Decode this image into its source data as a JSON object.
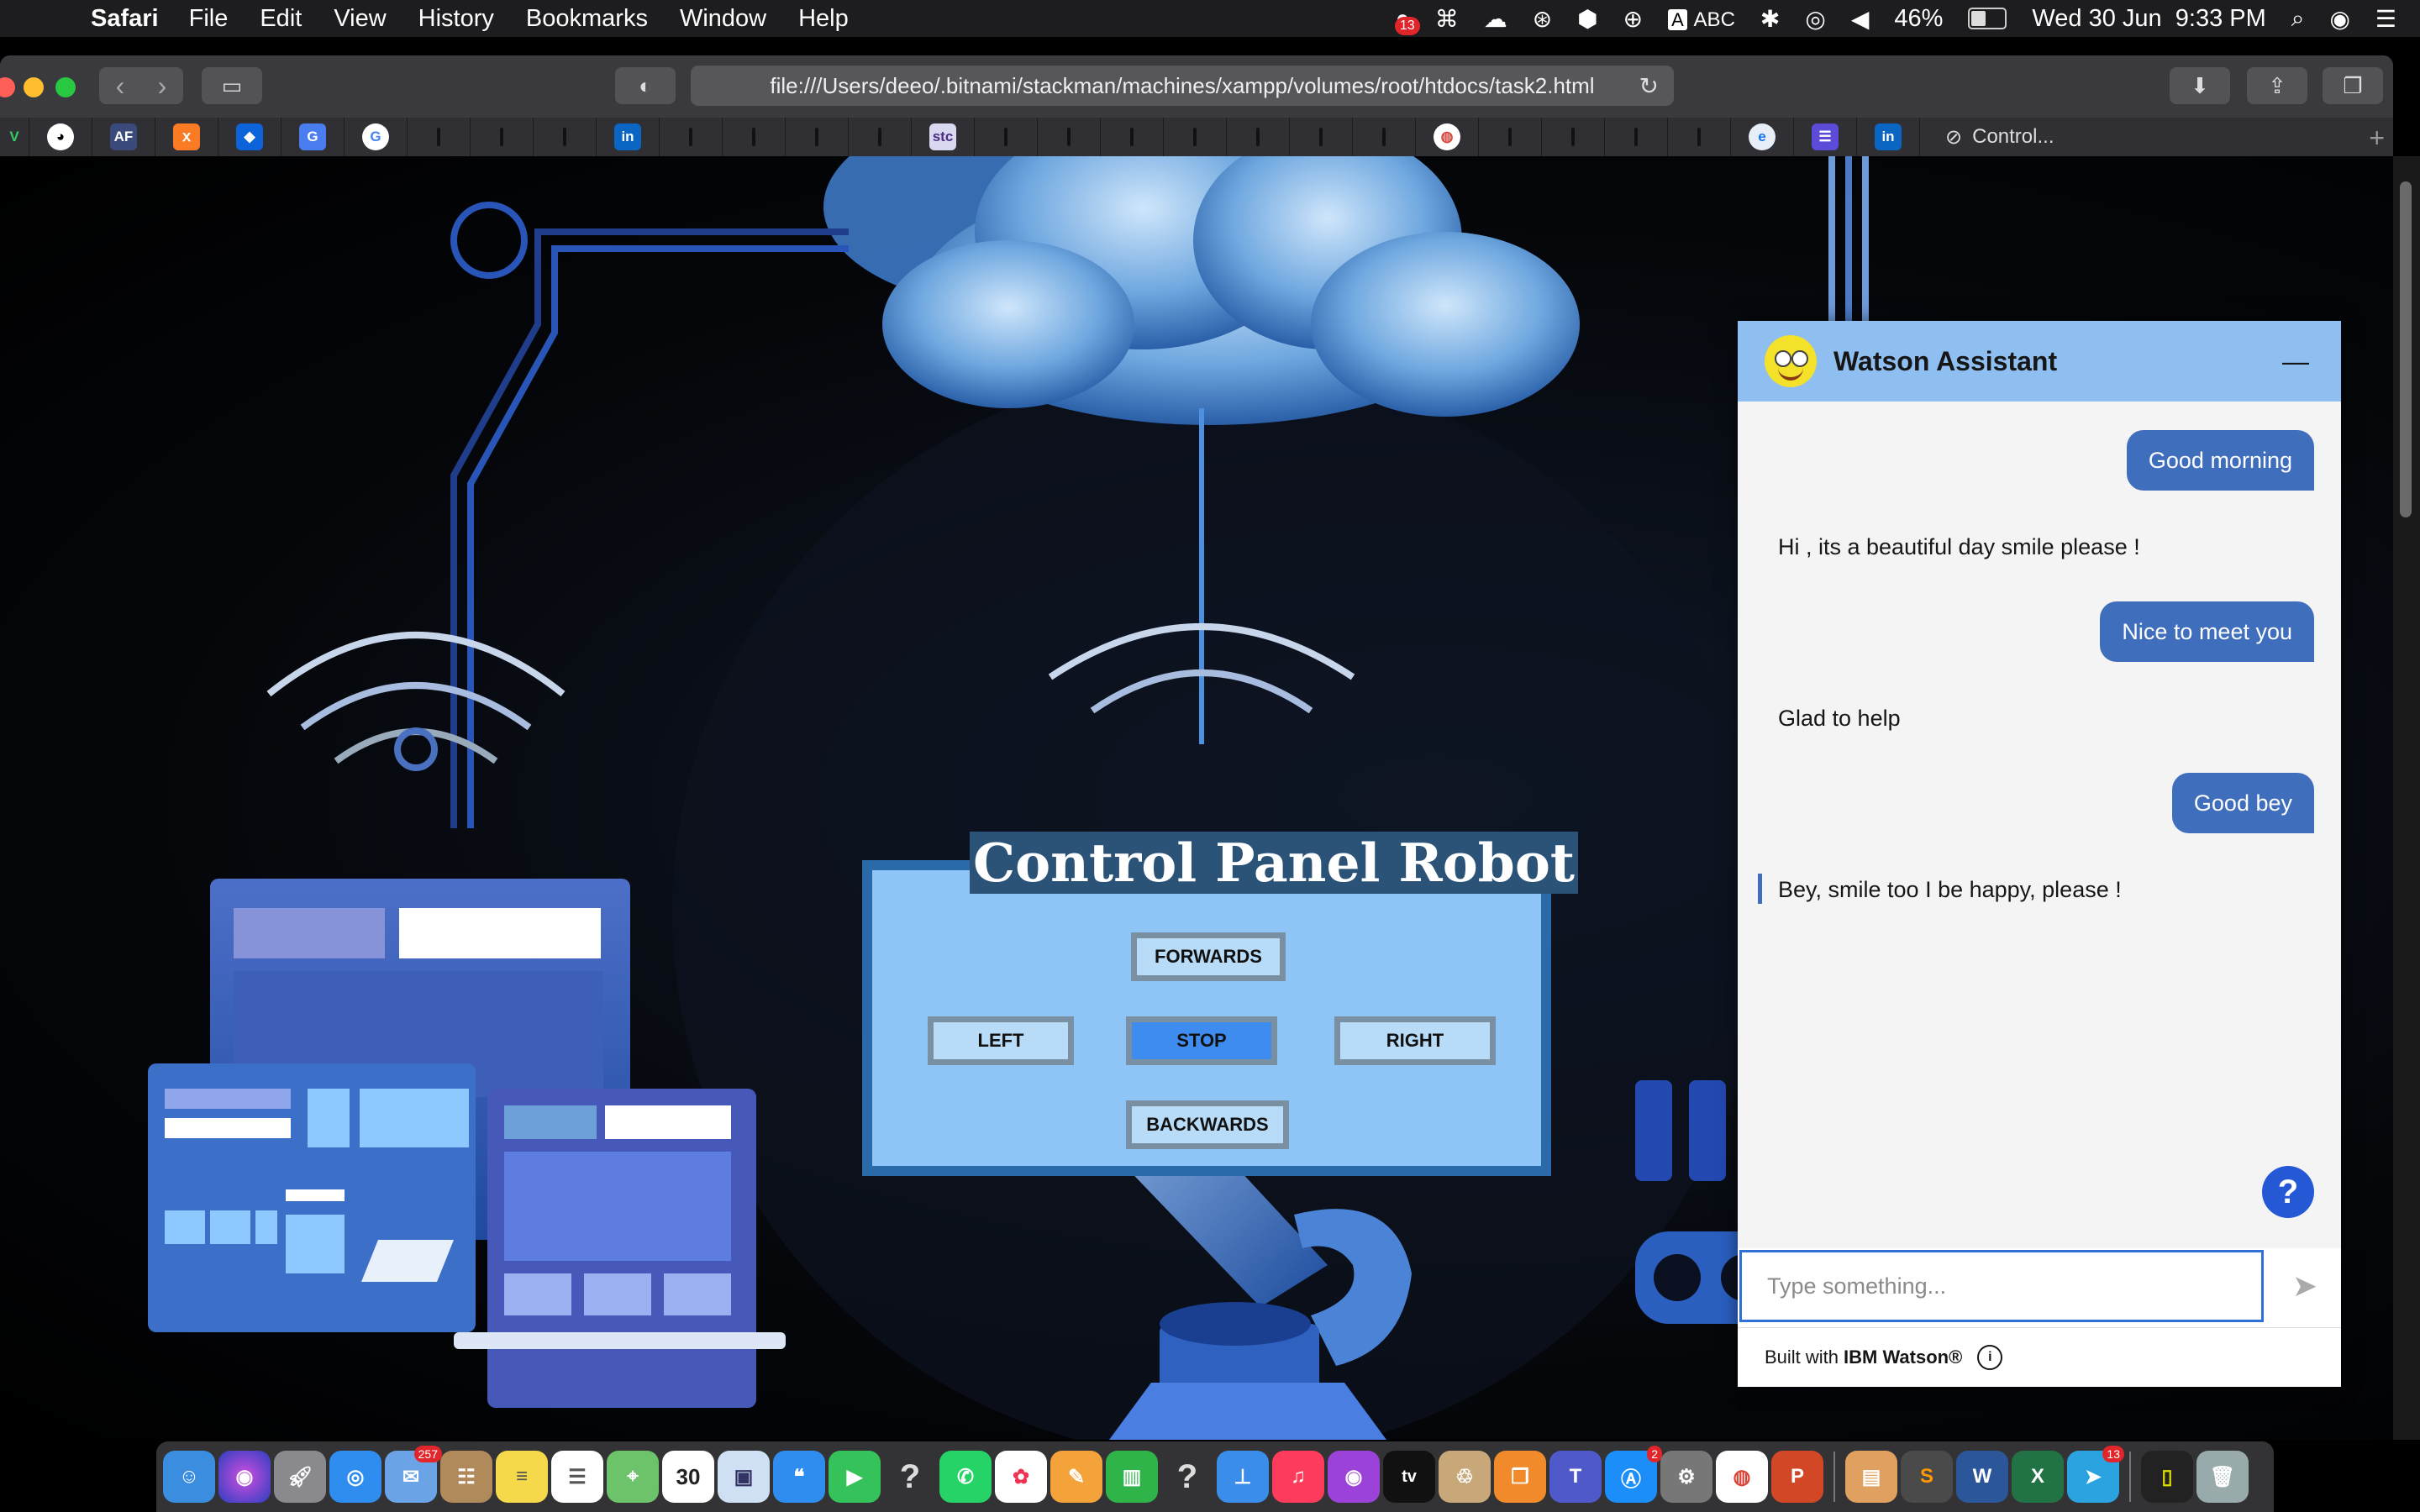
{
  "menubar": {
    "app_name": "Safari",
    "menus": [
      "File",
      "Edit",
      "View",
      "History",
      "Bookmarks",
      "Window",
      "Help"
    ],
    "status": {
      "notification_badge": "13",
      "input_source": "ABC",
      "battery_percent": "46%",
      "battery_level": 0.46,
      "datetime": "Wed 30 Jun  9:33 PM"
    }
  },
  "browser": {
    "url": "file:///Users/deeo/.bitnami/stackman/machines/xampp/volumes/root/htdocs/task2.html",
    "active_tab_label": "Control...",
    "favorites": [
      "github-icon",
      "af-icon",
      "xampp-icon",
      "dropbox-icon",
      "google-translate-icon",
      "google-icon",
      "linkedin-icon",
      "stc-icon",
      "chrome-icon",
      "edge-icon",
      "list-icon",
      "linkedin-icon"
    ],
    "fav_labels": {
      "af": "AF",
      "stc": "stc",
      "linkedin": "in"
    }
  },
  "control_panel": {
    "title": "Control Panel Robot",
    "buttons": {
      "forwards": "FORWARDS",
      "left": "LEFT",
      "stop": "STOP",
      "right": "RIGHT",
      "backwards": "BACKWARDS"
    },
    "active_button": "stop"
  },
  "watson": {
    "title": "Watson Assistant",
    "minimize": "—",
    "messages": [
      {
        "from": "user",
        "text": "Good morning"
      },
      {
        "from": "bot",
        "text": "Hi , its a beautiful day smile please !"
      },
      {
        "from": "user",
        "text": "Nice to meet you"
      },
      {
        "from": "bot",
        "text": "Glad to help"
      },
      {
        "from": "user",
        "text": "Good bey"
      },
      {
        "from": "bot",
        "text": "Bey, smile too I be happy, please !"
      }
    ],
    "help_button": "?",
    "input_placeholder": "Type something...",
    "footer_prefix": "Built with ",
    "footer_brand": "IBM Watson®",
    "info_icon": "i"
  },
  "dock": {
    "apps": [
      "finder-icon",
      "siri-icon",
      "launchpad-icon",
      "safari-icon",
      "mail-icon",
      "contacts-icon",
      "notes-icon",
      "reminders-icon",
      "maps-icon",
      "calendar-icon",
      "box-icon",
      "messages-icon",
      "facetime-icon",
      "unknown-icon",
      "whatsapp-icon",
      "photos-icon",
      "pages-icon",
      "numbers-icon",
      "unknown-icon",
      "keynote-icon",
      "music-icon",
      "podcasts-icon",
      "tv-icon",
      "archive-icon",
      "books-icon",
      "teams-icon",
      "app-store-icon",
      "system-preferences-icon",
      "chrome-icon",
      "powerpoint-icon",
      "preview-icon",
      "sublime-icon",
      "word-icon",
      "excel-icon",
      "telegram-icon",
      "terminal-icon",
      "trash-icon"
    ],
    "mail_badge": "257",
    "calendar_day": "30",
    "appstore_badge": "2",
    "telegram_badge": "13",
    "tv_label": "tv"
  },
  "colors": {
    "cp_border": "#2b6aa8",
    "cp_fill": "#8fc4f6",
    "watson_header": "#8fbef0",
    "user_bubble": "#3f6ebd",
    "help_button": "#2458d4"
  }
}
